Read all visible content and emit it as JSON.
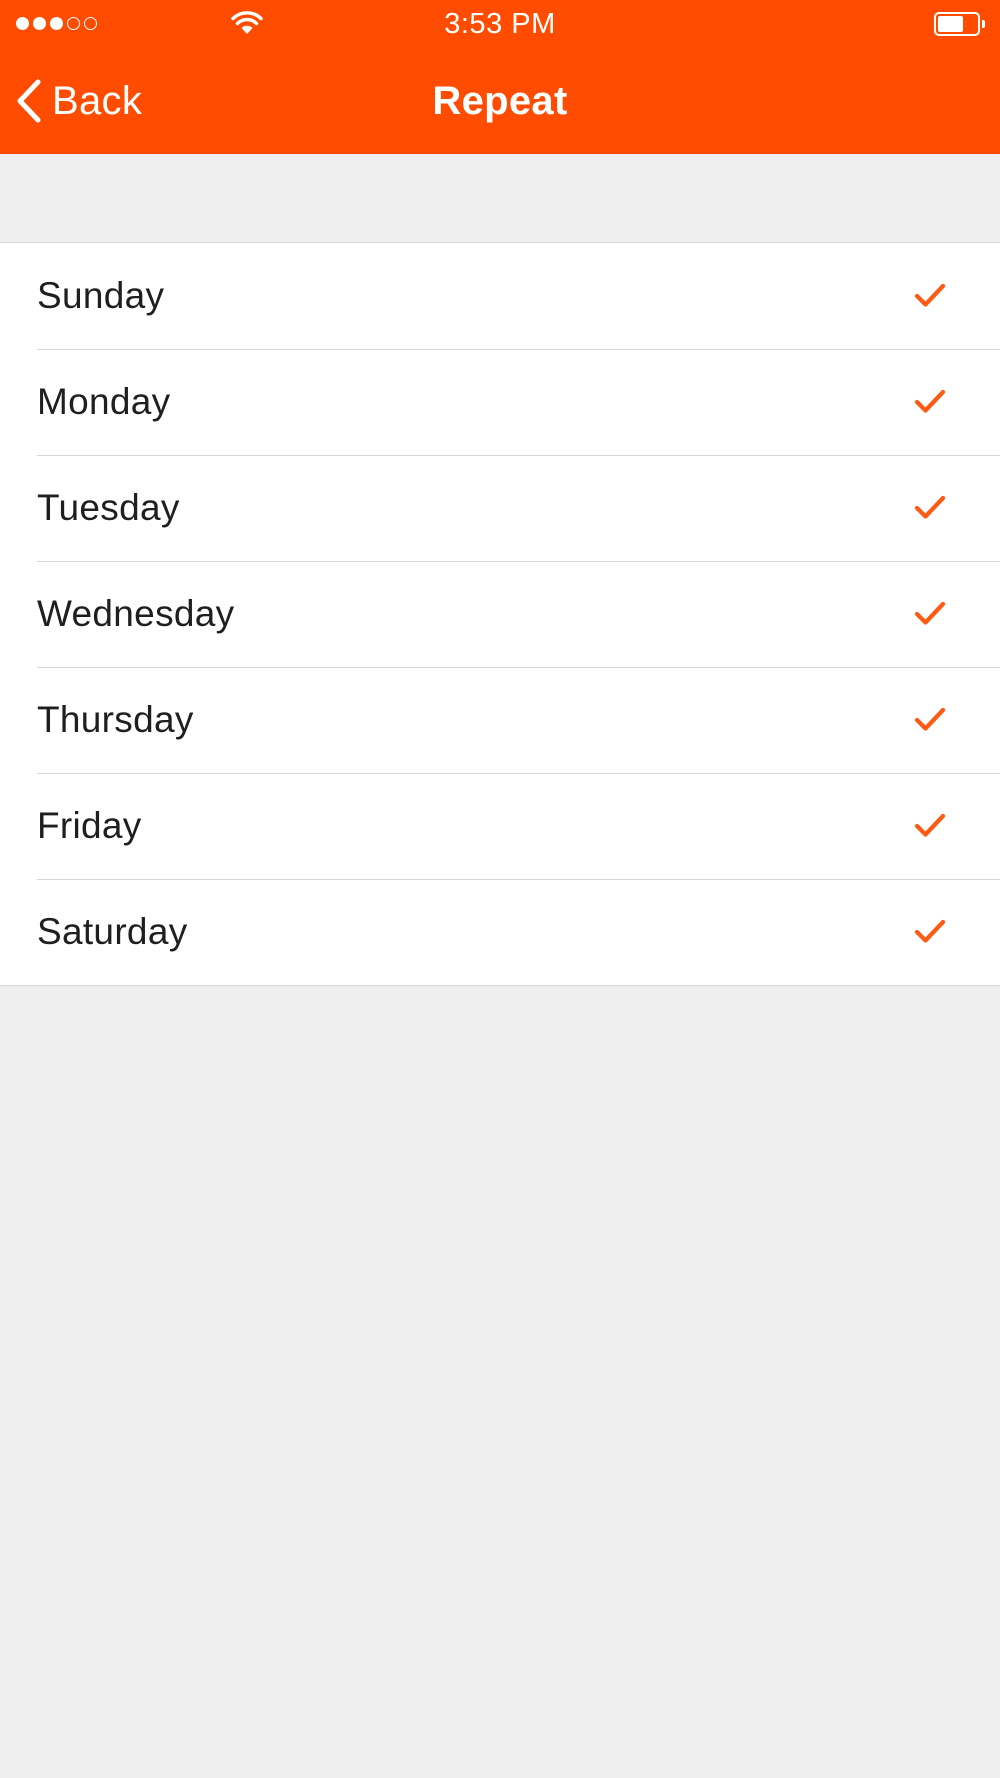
{
  "status_bar": {
    "time": "3:53 PM",
    "signal_bars_filled": 3,
    "signal_bars_total": 5,
    "battery_level": 0.65,
    "icons": [
      "signal-dots-icon",
      "wifi-icon",
      "battery-icon"
    ]
  },
  "nav": {
    "back_label": "Back",
    "title": "Repeat",
    "back_icon": "chevron-left-icon"
  },
  "days": [
    {
      "label": "Sunday",
      "checked": true
    },
    {
      "label": "Monday",
      "checked": true
    },
    {
      "label": "Tuesday",
      "checked": true
    },
    {
      "label": "Wednesday",
      "checked": true
    },
    {
      "label": "Thursday",
      "checked": true
    },
    {
      "label": "Friday",
      "checked": true
    },
    {
      "label": "Saturday",
      "checked": true
    }
  ],
  "colors": {
    "accent": "#ff4c00",
    "check": "#ff5a14",
    "background": "#efefef",
    "row_text": "#1f1f1f"
  }
}
